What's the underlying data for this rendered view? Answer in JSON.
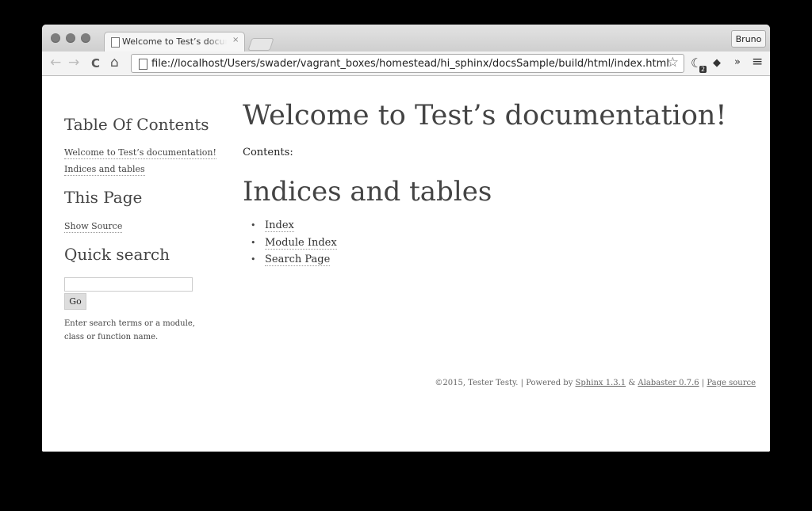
{
  "browser": {
    "tab_title": "Welcome to Test’s documentation!",
    "tab_close": "×",
    "profile": "Bruno",
    "url": "file://localhost/Users/swader/vagrant_boxes/homestead/hi_sphinx/docsSample/build/html/index.html",
    "back_glyph": "←",
    "forward_glyph": "→",
    "reload_glyph": "C",
    "home_glyph": "⌂",
    "star_glyph": "☆",
    "ext_badge": "2",
    "overflow_glyph": "»",
    "menu_glyph": "≡"
  },
  "sidebar": {
    "toc_heading": "Table Of Contents",
    "toc_items": [
      "Welcome to Test’s documentation!",
      "Indices and tables"
    ],
    "this_page_heading": "This Page",
    "show_source": "Show Source",
    "quick_search_heading": "Quick search",
    "go_label": "Go",
    "search_hint": "Enter search terms or a module, class or function name."
  },
  "main": {
    "title": "Welcome to Test’s documentation!",
    "contents_label": "Contents:",
    "indices_heading": "Indices and tables",
    "links": [
      "Index",
      "Module Index",
      "Search Page"
    ]
  },
  "footer": {
    "copyright": "©2015, Tester Testy. | Powered by ",
    "sphinx": "Sphinx 1.3.1",
    "amp": " & ",
    "alabaster": "Alabaster 0.7.6",
    "sep": " | ",
    "page_source": "Page source"
  }
}
